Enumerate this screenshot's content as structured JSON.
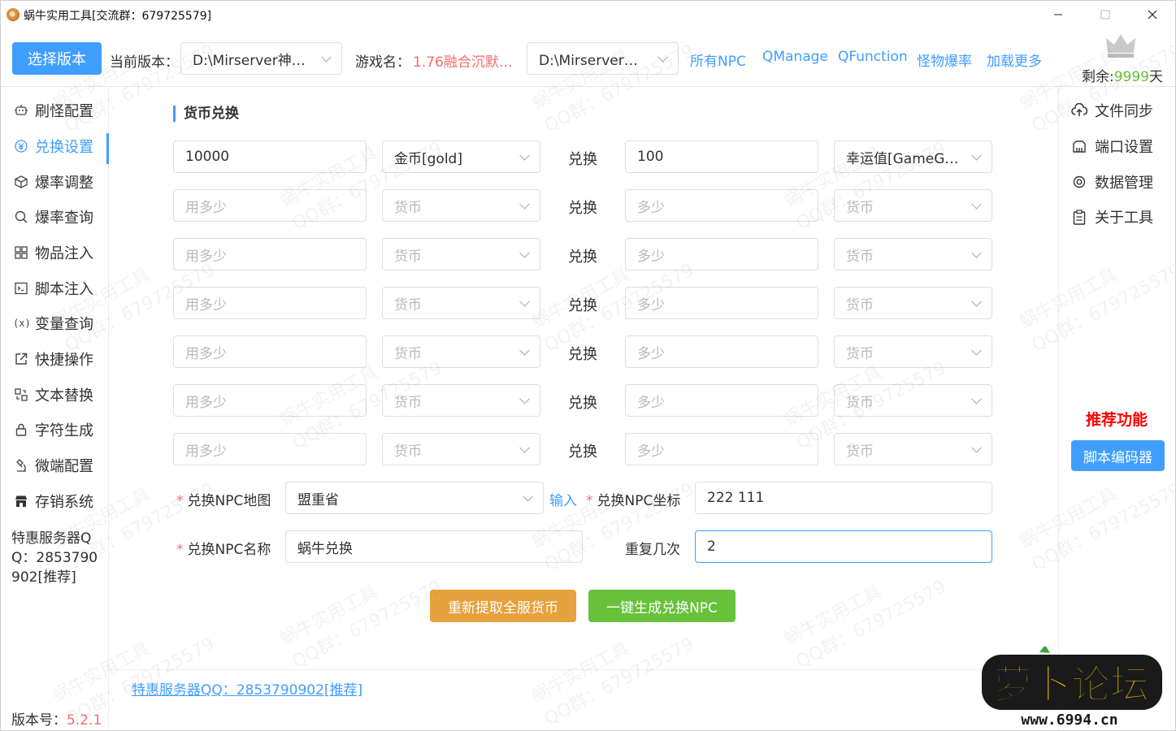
{
  "window": {
    "title": "蜗牛实用工具[交流群：679725579]"
  },
  "topbar": {
    "select_version_label": "选择版本",
    "current_version_label": "当前版本：",
    "current_version_value": "D:\\Mirserver神…",
    "game_name_label": "游戏名：",
    "game_name_value": "1.76融合沉默…",
    "second_path_value": "D:\\Mirserver神…",
    "links": [
      "所有NPC",
      "QManage",
      "QFunction",
      "怪物爆率",
      "加载更多"
    ],
    "remaining_label": "剩余:",
    "remaining_days": "9999",
    "remaining_unit": "天"
  },
  "sidebar": {
    "items": [
      {
        "label": "刷怪配置",
        "icon": "robot-icon"
      },
      {
        "label": "兑换设置",
        "icon": "currency-icon",
        "active": true
      },
      {
        "label": "爆率调整",
        "icon": "box-icon"
      },
      {
        "label": "爆率查询",
        "icon": "search-icon"
      },
      {
        "label": "物品注入",
        "icon": "grid-icon"
      },
      {
        "label": "脚本注入",
        "icon": "terminal-icon"
      },
      {
        "label": "变量查询",
        "icon": "variable-icon"
      },
      {
        "label": "快捷操作",
        "icon": "external-link-icon"
      },
      {
        "label": "文本替换",
        "icon": "replace-icon"
      },
      {
        "label": "字符生成",
        "icon": "lock-icon"
      },
      {
        "label": "微端配置",
        "icon": "microscope-icon"
      },
      {
        "label": "存销系统",
        "icon": "store-icon"
      }
    ],
    "promo": "特惠服务器QQ：2853790902[推荐]",
    "version_label": "版本号：",
    "version_value": "5.2.1"
  },
  "main": {
    "section_title": "货币兑换",
    "exchange_word": "兑换",
    "rows": [
      {
        "amount": "10000",
        "from": "金币[gold]",
        "to_amount": "100",
        "to": "幸运值[GameG…",
        "filled": true
      },
      {
        "amount": "",
        "from": "",
        "to_amount": "",
        "to": ""
      },
      {
        "amount": "",
        "from": "",
        "to_amount": "",
        "to": ""
      },
      {
        "amount": "",
        "from": "",
        "to_amount": "",
        "to": ""
      },
      {
        "amount": "",
        "from": "",
        "to_amount": "",
        "to": ""
      },
      {
        "amount": "",
        "from": "",
        "to_amount": "",
        "to": ""
      },
      {
        "amount": "",
        "from": "",
        "to_amount": "",
        "to": ""
      }
    ],
    "placeholders": {
      "amount": "用多少",
      "currency": "货币",
      "to_amount": "多少"
    },
    "npc_map_label": "兑换NPC地图",
    "npc_map_value": "盟重省",
    "input_link": "输入",
    "npc_coord_label": "兑换NPC坐标",
    "npc_coord_value": "222 111",
    "npc_name_label": "兑换NPC名称",
    "npc_name_value": "蜗牛兑换",
    "repeat_label": "重复几次",
    "repeat_value": "2",
    "refetch_button": "重新提取全服货币",
    "generate_button": "一键生成兑换NPC",
    "bottom_link": "特惠服务器QQ：2853790902[推荐]"
  },
  "right_panel": {
    "items": [
      {
        "label": "文件同步",
        "icon": "cloud-upload-icon"
      },
      {
        "label": "端口设置",
        "icon": "port-icon"
      },
      {
        "label": "数据管理",
        "icon": "gear-icon"
      },
      {
        "label": "关于工具",
        "icon": "clipboard-icon"
      }
    ],
    "recommend_title": "推荐功能",
    "script_encoder_button": "脚本编码器"
  },
  "watermark": {
    "line1": "蜗牛实用工具",
    "line2": "QQ群：679725579"
  },
  "logo": {
    "main": "萝卜论坛",
    "url": "www.6994.cn"
  },
  "colors": {
    "primary": "#409eff",
    "danger": "#f56c6c",
    "success": "#67c23a",
    "warning": "#e6a23c"
  }
}
